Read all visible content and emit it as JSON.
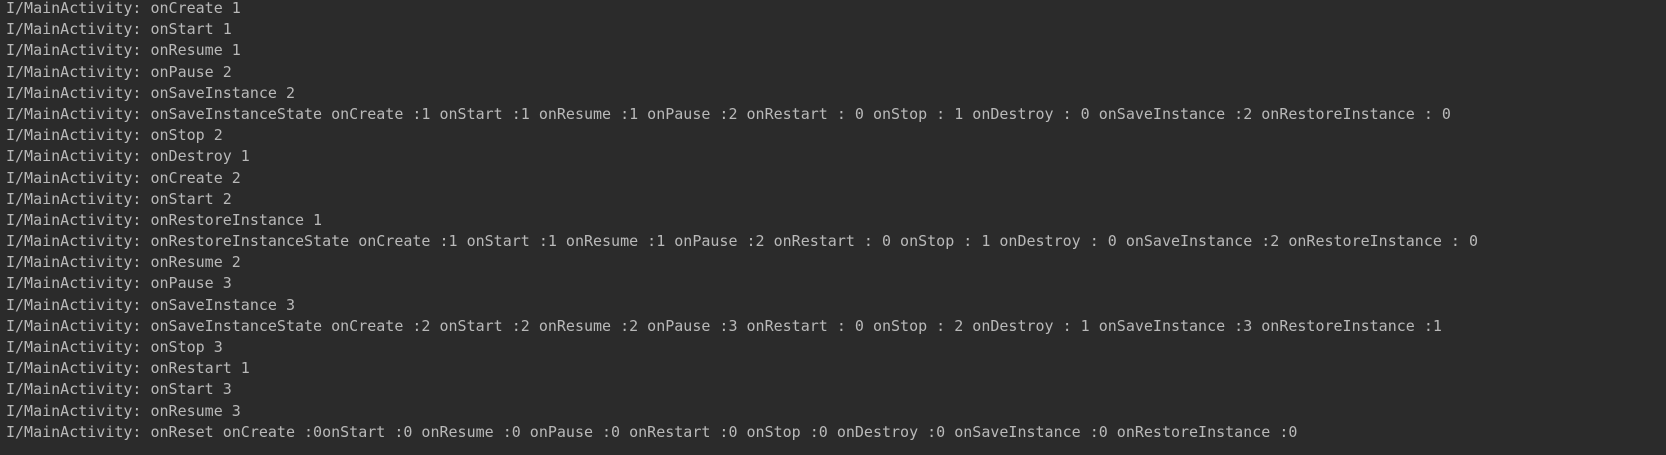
{
  "logcat": {
    "lines": [
      "I/MainActivity: onCreate 1",
      "I/MainActivity: onStart 1",
      "I/MainActivity: onResume 1",
      "I/MainActivity: onPause 2",
      "I/MainActivity: onSaveInstance 2",
      "I/MainActivity: onSaveInstanceState onCreate :1 onStart :1 onResume :1 onPause :2 onRestart : 0 onStop : 1 onDestroy : 0 onSaveInstance :2 onRestoreInstance : 0",
      "I/MainActivity: onStop 2",
      "I/MainActivity: onDestroy 1",
      "I/MainActivity: onCreate 2",
      "I/MainActivity: onStart 2",
      "I/MainActivity: onRestoreInstance 1",
      "I/MainActivity: onRestoreInstanceState onCreate :1 onStart :1 onResume :1 onPause :2 onRestart : 0 onStop : 1 onDestroy : 0 onSaveInstance :2 onRestoreInstance : 0",
      "I/MainActivity: onResume 2",
      "I/MainActivity: onPause 3",
      "I/MainActivity: onSaveInstance 3",
      "I/MainActivity: onSaveInstanceState onCreate :2 onStart :2 onResume :2 onPause :3 onRestart : 0 onStop : 2 onDestroy : 1 onSaveInstance :3 onRestoreInstance :1",
      "I/MainActivity: onStop 3",
      "I/MainActivity: onRestart 1",
      "I/MainActivity: onStart 3",
      "I/MainActivity: onResume 3",
      "I/MainActivity: onReset onCreate :0onStart :0 onResume :0 onPause :0 onRestart :0 onStop :0 onDestroy :0 onSaveInstance :0 onRestoreInstance :0"
    ]
  },
  "colors": {
    "background": "#2b2b2b",
    "text": "#b9b9b9"
  }
}
